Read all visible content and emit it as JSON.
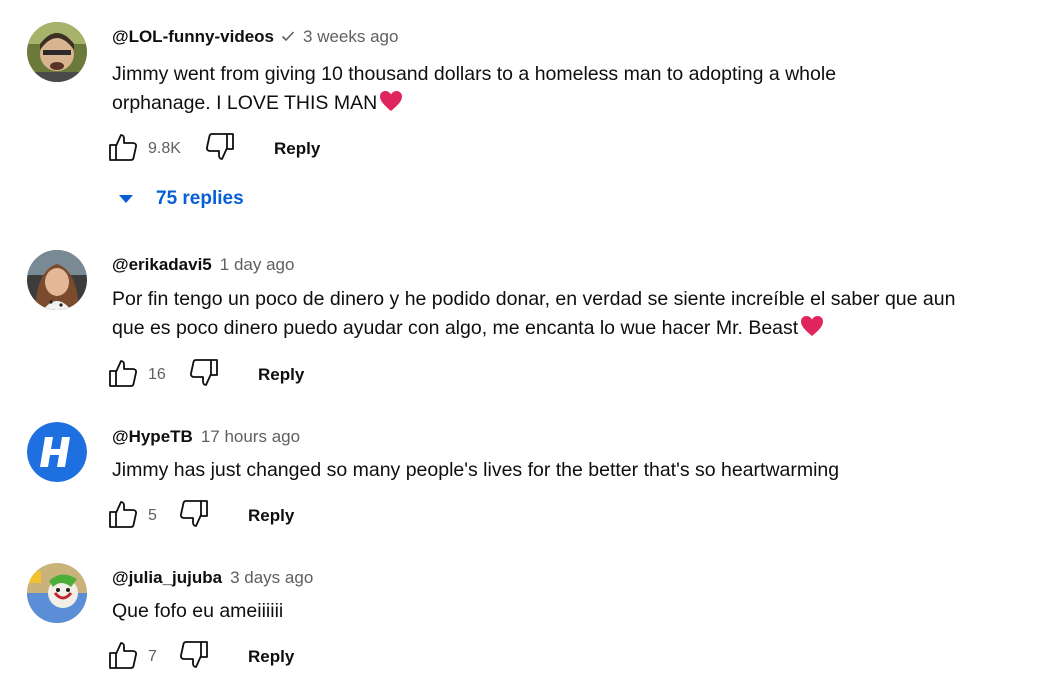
{
  "comments": [
    {
      "author": "@LOL-funny-videos",
      "verified": true,
      "time": "3 weeks ago",
      "text_line1": "Jimmy went from giving 10 thousand dollars to a homeless man to adopting a whole",
      "text_line2": "orphanage. I LOVE THIS MAN",
      "likes": "9.8K",
      "reply_label": "Reply",
      "replies_label": "75 replies"
    },
    {
      "author": "@erikadavi5",
      "verified": false,
      "time": "1 day ago",
      "text_line1": "Por fin tengo un poco de dinero y he podido donar, en verdad se siente increíble el saber que aun",
      "text_line2": "que es poco dinero puedo ayudar con algo, me encanta lo wue hacer Mr. Beast",
      "likes": "16",
      "reply_label": "Reply"
    },
    {
      "author": "@HypeTB",
      "verified": false,
      "time": "17 hours ago",
      "text_line1": "Jimmy has just changed so many people's lives for the better that's so heartwarming",
      "likes": "5",
      "reply_label": "Reply"
    },
    {
      "author": "@julia_jujuba",
      "verified": false,
      "time": "3 days ago",
      "text_line1": "Que fofo eu ameiiiiii",
      "likes": "7",
      "reply_label": "Reply"
    }
  ],
  "icons": {
    "like": "thumbs-up-icon",
    "dislike": "thumbs-down-icon",
    "verified": "checkmark-icon",
    "heart": "red-heart-emoji",
    "expand": "caret-down-icon"
  },
  "colors": {
    "link_blue": "#065fd4",
    "secondary_text": "#606060",
    "heart_red": "#e0245e",
    "hype_avatar_blue": "#1e6fe0"
  }
}
